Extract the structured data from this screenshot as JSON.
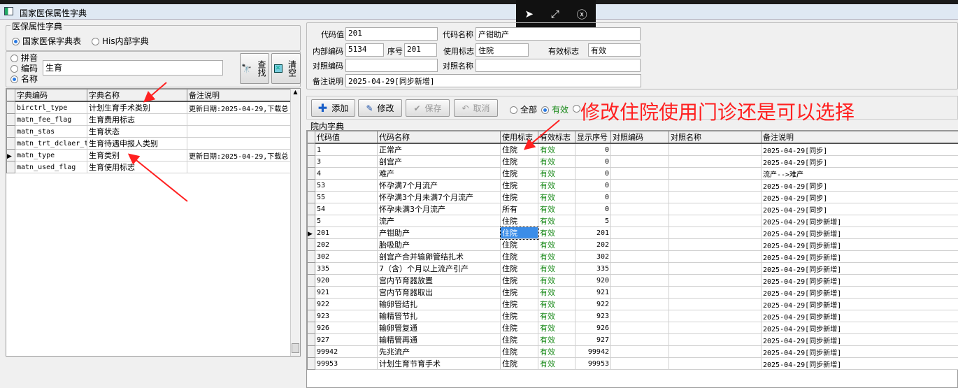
{
  "window": {
    "title": "国家医保属性字典"
  },
  "floatbar": {
    "icons": [
      "send-icon",
      "resize-icon",
      "close-circle-icon"
    ]
  },
  "left": {
    "group_title": "医保属性字典",
    "source_options": [
      {
        "label": "国家医保字典表",
        "selected": true
      },
      {
        "label": "His内部字典",
        "selected": false
      }
    ],
    "search_modes": [
      {
        "label": "拼音",
        "selected": false
      },
      {
        "label": "编码",
        "selected": false
      },
      {
        "label": "名称",
        "selected": true
      }
    ],
    "search_value": "生育",
    "find_label": "查找",
    "clear_label": "清空",
    "columns": [
      "字典编码",
      "字典名称",
      "备注说明"
    ],
    "rows": [
      {
        "code": "birctrl_type",
        "name": "计划生育手术类别",
        "remark": "更新日期:2025-04-29,下载总"
      },
      {
        "code": "matn_fee_flag",
        "name": "生育费用标志",
        "remark": ""
      },
      {
        "code": "matn_stas",
        "name": "生育状态",
        "remark": ""
      },
      {
        "code": "matn_trt_dclaer_ty",
        "name": "生育待遇申报人类别",
        "remark": ""
      },
      {
        "code": "matn_type",
        "name": "生育类别",
        "remark": "更新日期:2025-04-29,下载总",
        "current": true
      },
      {
        "code": "matn_used_flag",
        "name": "生育使用标志",
        "remark": ""
      }
    ]
  },
  "form": {
    "code_label": "代码值",
    "code": "201",
    "name_label": "代码名称",
    "name": "产钳助产",
    "inner_code_label": "内部编码",
    "inner_code": "5134",
    "seq_label": "序号",
    "seq": "201",
    "use_flag_label": "使用标志",
    "use_flag": "住院",
    "valid_flag_label": "有效标志",
    "valid_flag": "有效",
    "ref_code_label": "对照编码",
    "ref_code": "",
    "ref_name_label": "对照名称",
    "ref_name": "",
    "remark_label": "备注说明",
    "remark": "2025-04-29[同步新增]"
  },
  "toolbar": {
    "add": "添加",
    "edit": "修改",
    "save": "保存",
    "cancel": "取消",
    "filter_all": "全部",
    "filter_valid": "有效"
  },
  "annotation": "修改住院使用门诊还是可以选择",
  "grid": {
    "title": "院内字典",
    "columns": [
      "代码值",
      "代码名称",
      "使用标志",
      "有效标志",
      "显示序号",
      "对照编码",
      "对照名称",
      "备注说明"
    ],
    "rows": [
      [
        "1",
        "正常产",
        "住院",
        "有效",
        "0",
        "",
        "",
        "2025-04-29[同步]"
      ],
      [
        "3",
        "剖宫产",
        "住院",
        "有效",
        "0",
        "",
        "",
        "2025-04-29[同步]"
      ],
      [
        "4",
        "难产",
        "住院",
        "有效",
        "0",
        "",
        "",
        "流产-->难产"
      ],
      [
        "53",
        "怀孕满7个月流产",
        "住院",
        "有效",
        "0",
        "",
        "",
        "2025-04-29[同步]"
      ],
      [
        "55",
        "怀孕满3个月未满7个月流产",
        "住院",
        "有效",
        "0",
        "",
        "",
        "2025-04-29[同步]"
      ],
      [
        "54",
        "怀孕未满3个月流产",
        "所有",
        "有效",
        "0",
        "",
        "",
        "2025-04-29[同步]"
      ],
      [
        "5",
        "流产",
        "住院",
        "有效",
        "5",
        "",
        "",
        "2025-04-29[同步新增]"
      ],
      [
        "201",
        "产钳助产",
        "住院",
        "有效",
        "201",
        "",
        "",
        "2025-04-29[同步新增]"
      ],
      [
        "202",
        "胎吸助产",
        "住院",
        "有效",
        "202",
        "",
        "",
        "2025-04-29[同步新增]"
      ],
      [
        "302",
        "剖宫产合并输卵管结扎术",
        "住院",
        "有效",
        "302",
        "",
        "",
        "2025-04-29[同步新增]"
      ],
      [
        "335",
        "7（含）个月以上流产引产",
        "住院",
        "有效",
        "335",
        "",
        "",
        "2025-04-29[同步新增]"
      ],
      [
        "920",
        "宫内节育器放置",
        "住院",
        "有效",
        "920",
        "",
        "",
        "2025-04-29[同步新增]"
      ],
      [
        "921",
        "宫内节育器取出",
        "住院",
        "有效",
        "921",
        "",
        "",
        "2025-04-29[同步新增]"
      ],
      [
        "922",
        "输卵管结扎",
        "住院",
        "有效",
        "922",
        "",
        "",
        "2025-04-29[同步新增]"
      ],
      [
        "923",
        "输精管节扎",
        "住院",
        "有效",
        "923",
        "",
        "",
        "2025-04-29[同步新增]"
      ],
      [
        "926",
        "输卵管复通",
        "住院",
        "有效",
        "926",
        "",
        "",
        "2025-04-29[同步新增]"
      ],
      [
        "927",
        "输精管再通",
        "住院",
        "有效",
        "927",
        "",
        "",
        "2025-04-29[同步新增]"
      ],
      [
        "99942",
        "先兆流产",
        "住院",
        "有效",
        "99942",
        "",
        "",
        "2025-04-29[同步新增]"
      ],
      [
        "99953",
        "计划生育节育手术",
        "住院",
        "有效",
        "99953",
        "",
        "",
        "2025-04-29[同步新增]"
      ]
    ],
    "current_row": 7
  },
  "colors": {
    "annotation": "#ff2020",
    "valid": "#1a8a1a",
    "selection": "#3b8de8"
  }
}
